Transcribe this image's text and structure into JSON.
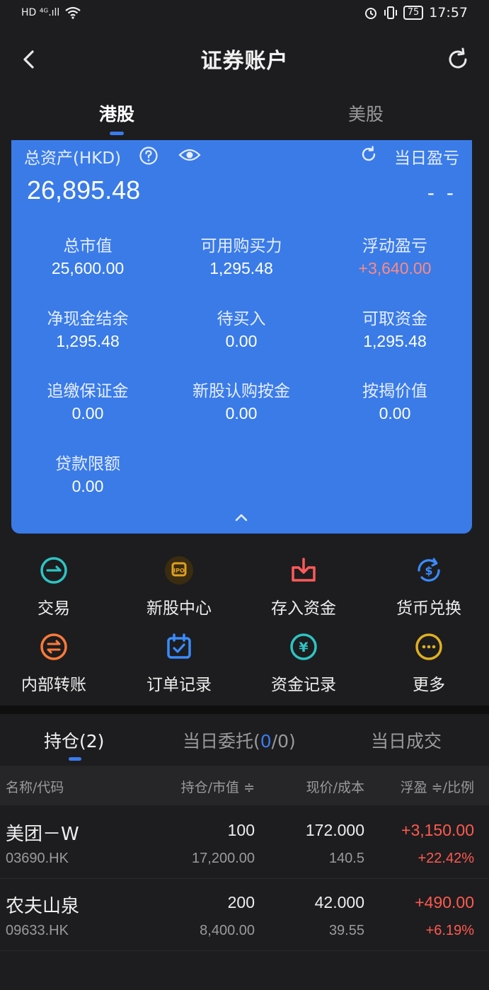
{
  "status_bar": {
    "left": "HD ⁴ᴳ.ıll",
    "battery": "75",
    "time": "17:57"
  },
  "header": {
    "title": "证券账户"
  },
  "market_tabs": [
    "港股",
    "美股"
  ],
  "account_card": {
    "total_assets_label": "总资产(HKD)",
    "total_assets_value": "26,895.48",
    "daily_pnl_label": "当日盈亏",
    "daily_pnl_value": "- -",
    "metrics": [
      {
        "label": "总市值",
        "value": "25,600.00"
      },
      {
        "label": "可用购买力",
        "value": "1,295.48"
      },
      {
        "label": "浮动盈亏",
        "value": "+3,640.00"
      },
      {
        "label": "净现金结余",
        "value": "1,295.48"
      },
      {
        "label": "待买入",
        "value": "0.00"
      },
      {
        "label": "可取资金",
        "value": "1,295.48"
      },
      {
        "label": "追缴保证金",
        "value": "0.00"
      },
      {
        "label": "新股认购按金",
        "value": "0.00"
      },
      {
        "label": "按揭价值",
        "value": "0.00"
      },
      {
        "label": "贷款限额",
        "value": "0.00"
      }
    ]
  },
  "quick_actions": [
    {
      "label": "交易",
      "icon": "trade-icon",
      "color": "#2ec4c4"
    },
    {
      "label": "新股中心",
      "icon": "ipo-icon",
      "color": "#e0a020"
    },
    {
      "label": "存入资金",
      "icon": "deposit-icon",
      "color": "#ff5a5a"
    },
    {
      "label": "货币兑换",
      "icon": "currency-exchange-icon",
      "color": "#3a8bff"
    },
    {
      "label": "内部转账",
      "icon": "transfer-icon",
      "color": "#ff7a3a"
    },
    {
      "label": "订单记录",
      "icon": "order-record-icon",
      "color": "#3a8bff"
    },
    {
      "label": "资金记录",
      "icon": "fund-record-icon",
      "color": "#2ec4c4"
    },
    {
      "label": "更多",
      "icon": "more-icon",
      "color": "#e0b020"
    }
  ],
  "position_tabs": {
    "holdings": "持仓(2)",
    "orders_prefix": "当日委托(",
    "orders_count": "0",
    "orders_suffix": "/0)",
    "trades": "当日成交"
  },
  "table": {
    "headers": {
      "name": "名称/代码",
      "qty": "持仓/市值 ≑",
      "price": "现价/成本",
      "pnl": "浮盈 ≑/比例"
    },
    "rows": [
      {
        "name": "美团－W",
        "code": "03690.HK",
        "qty": "100",
        "market_value": "17,200.00",
        "price": "172.000",
        "cost": "140.5",
        "pnl": "+3,150.00",
        "pnl_pct": "+22.42%"
      },
      {
        "name": "农夫山泉",
        "code": "09633.HK",
        "qty": "200",
        "market_value": "8,400.00",
        "price": "42.000",
        "cost": "39.55",
        "pnl": "+490.00",
        "pnl_pct": "+6.19%"
      }
    ]
  }
}
